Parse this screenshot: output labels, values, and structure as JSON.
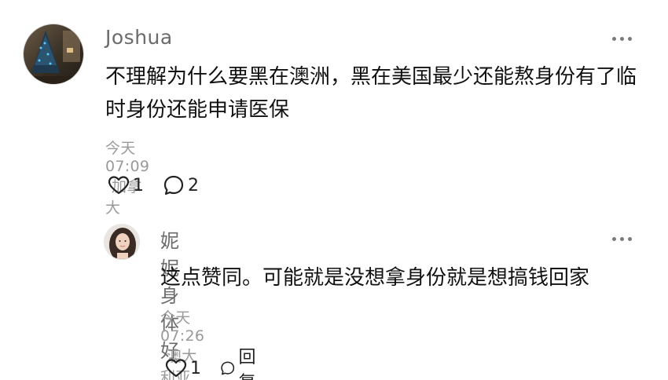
{
  "main_comment": {
    "username": "Joshua",
    "text": "不理解为什么要黑在澳洲，黑在美国最少还能熬身份有了临时身份还能申请医保",
    "time": "今天 07:09",
    "location": "加拿大",
    "likes": "1",
    "replies": "2",
    "avatar_icon": "avatar-christmas-tree",
    "more_icon": "more-dots-icon"
  },
  "reply_comment": {
    "username": "妮妮身体好",
    "text": "这点赞同。可能就是没想拿身份就是想搞钱回家",
    "time": "今天 07:26",
    "location": "澳大利亚",
    "likes": "1",
    "reply_label": "回复",
    "avatar_icon": "avatar-woman-photo",
    "more_icon": "more-dots-icon"
  },
  "colors": {
    "username": "#6b6b6b",
    "meta": "#9a9a9a",
    "body": "#111111",
    "icon": "#222222"
  }
}
